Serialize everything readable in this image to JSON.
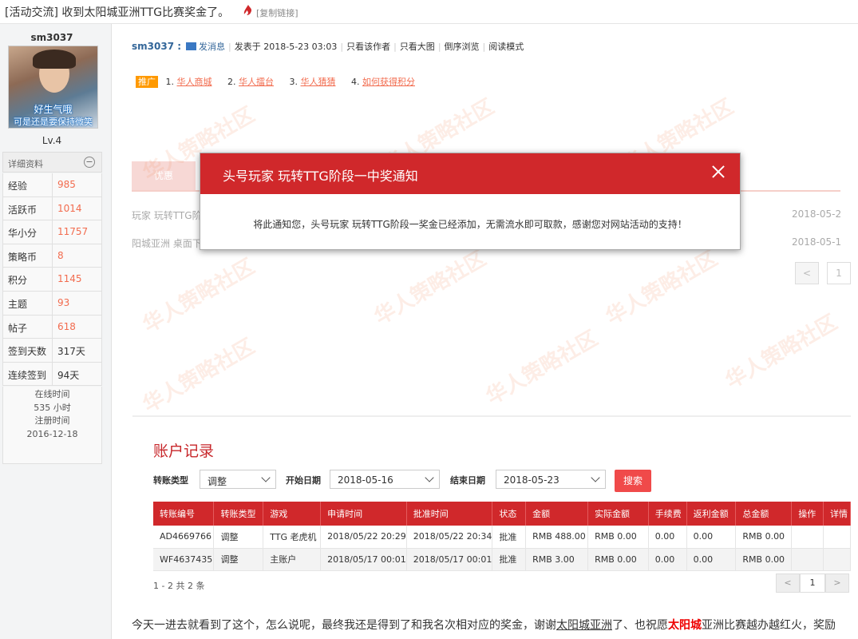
{
  "thread": {
    "title": "[活动交流] 收到太阳城亚洲TTG比赛奖金了。",
    "copy_link": "[复制链接]"
  },
  "user": {
    "name": "sm3037",
    "avatar_caption1": "好生气哦",
    "avatar_caption2": "可是还是要保持微笑",
    "level": "Lv.4",
    "detail_label": "详细资料",
    "stats": [
      {
        "label": "经验",
        "value": "985"
      },
      {
        "label": "活跃币",
        "value": "1014"
      },
      {
        "label": "华小分",
        "value": "11757"
      },
      {
        "label": "策略币",
        "value": "8"
      },
      {
        "label": "积分",
        "value": "1145"
      },
      {
        "label": "主题",
        "value": "93"
      },
      {
        "label": "帖子",
        "value": "618"
      },
      {
        "label": "签到天数",
        "value": "317天"
      },
      {
        "label": "连续签到",
        "value": "94天"
      }
    ],
    "online_label": "在线时间",
    "online_value": "535 小时",
    "reg_label": "注册时间",
    "reg_value": "2016-12-18"
  },
  "post_header": {
    "author": "sm3037 :",
    "send_msg": "发消息",
    "posted": "发表于 2018-5-23 03:03",
    "only_author": "只看该作者",
    "big_image": "只看大图",
    "reverse": "倒序浏览",
    "read_mode": "阅读模式"
  },
  "promo": {
    "tag": "推广",
    "items": [
      {
        "num": "1.",
        "label": "华人商城"
      },
      {
        "num": "2.",
        "label": "华人擂台"
      },
      {
        "num": "3.",
        "label": "华人猜猜"
      },
      {
        "num": "4.",
        "label": "如何获得积分"
      }
    ]
  },
  "background": {
    "tab": "优惠",
    "row1_left": "玩家 玩转TTG阶",
    "row1_right": "2018-05-2",
    "row2_left": "阳城亚洲 桌面下",
    "row2_right": "2018-05-1",
    "pager_prev": "<",
    "pager_num": "1"
  },
  "watermark": "华人策略社区",
  "modal": {
    "title": "头号玩家 玩转TTG阶段一中奖通知",
    "body": "将此通知您，头号玩家 玩转TTG阶段一奖金已经添加，无需流水即可取款，感谢您对网站活动的支持！"
  },
  "account": {
    "title": "账户记录",
    "type_label": "转账类型",
    "type_value": "调整",
    "start_label": "开始日期",
    "start_value": "2018-05-16",
    "end_label": "结束日期",
    "end_value": "2018-05-23",
    "search": "搜索",
    "columns": [
      "转账编号",
      "转账类型",
      "游戏",
      "申请时间",
      "批准时间",
      "状态",
      "金额",
      "实际金额",
      "手续费",
      "返利金额",
      "总金额",
      "操作",
      "详情"
    ],
    "rows": [
      [
        "AD4669766",
        "调整",
        "TTG 老虎机",
        "2018/05/22 20:29",
        "2018/05/22 20:34",
        "批准",
        "RMB 488.00",
        "RMB 0.00",
        "0.00",
        "0.00",
        "RMB 0.00",
        "",
        ""
      ],
      [
        "WF4637435",
        "调整",
        "主账户",
        "2018/05/17 00:01",
        "2018/05/17 00:01",
        "批准",
        "RMB 3.00",
        "RMB 0.00",
        "0.00",
        "0.00",
        "RMB 0.00",
        "",
        ""
      ]
    ],
    "summary": "1 - 2 共 2 条",
    "pager_prev": "<",
    "pager_num": "1",
    "pager_next": ">"
  },
  "post_text": {
    "p1": "今天一进去就看到了这个，怎么说呢，最终我还是得到了和我名次相对应的奖金，谢谢",
    "p2": "太阳城亚洲",
    "p3": "了、也祝愿",
    "p4": "太阳城",
    "p5": "亚洲比赛越办越红火，奖励"
  }
}
